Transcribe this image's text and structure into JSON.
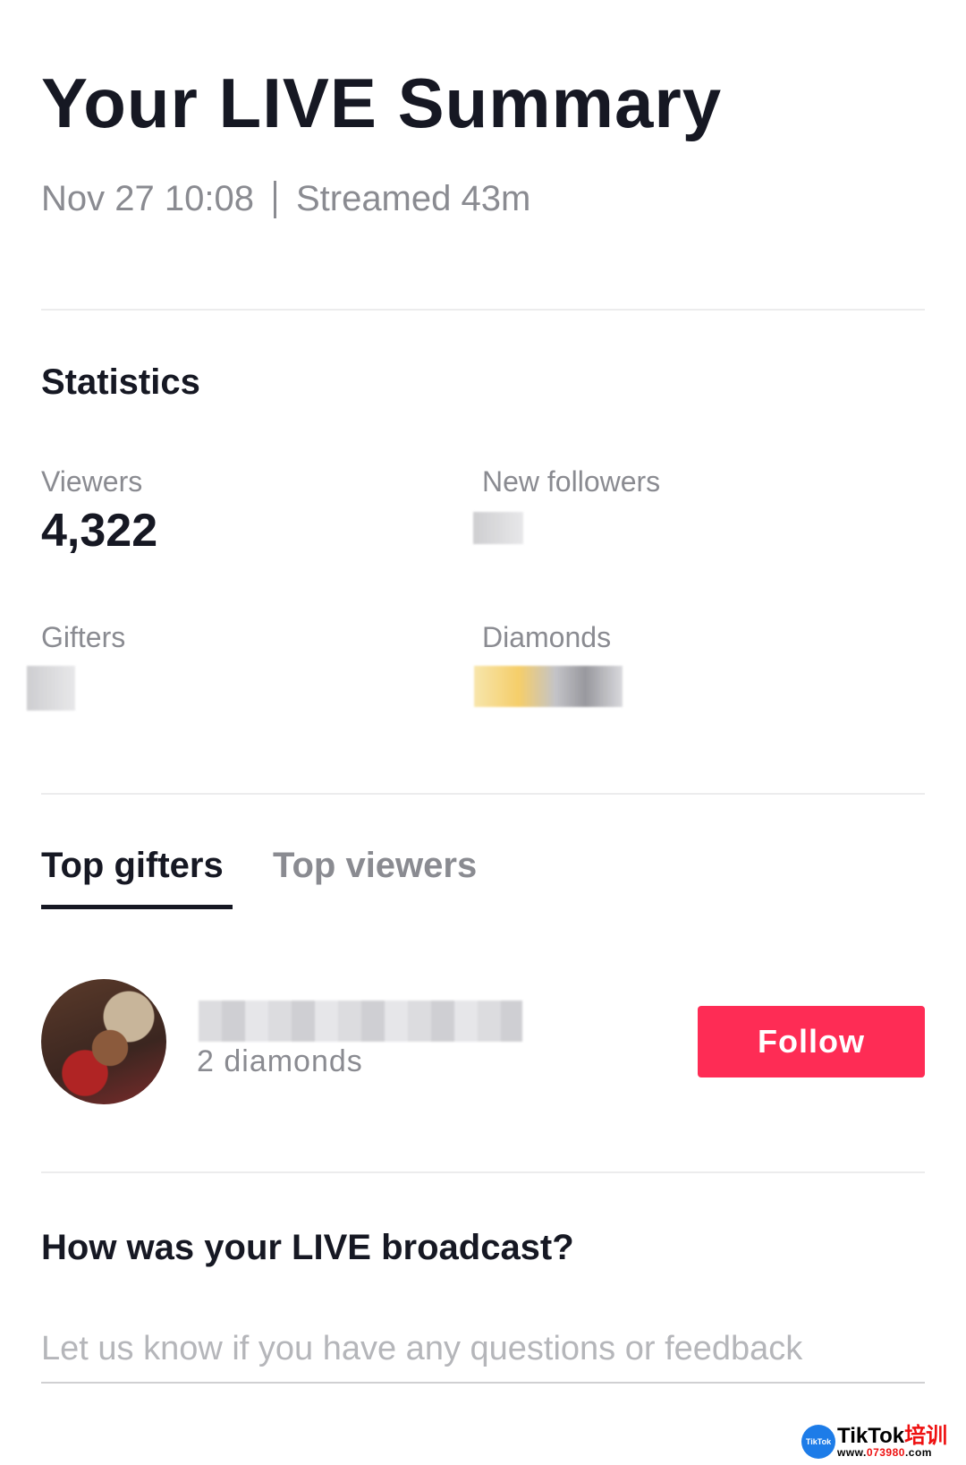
{
  "header": {
    "title": "Your LIVE Summary",
    "date": "Nov 27 10:08",
    "duration": "Streamed 43m"
  },
  "statistics": {
    "heading": "Statistics",
    "viewers_label": "Viewers",
    "viewers_value": "4,322",
    "new_followers_label": "New followers",
    "gifters_label": "Gifters",
    "diamonds_label": "Diamonds"
  },
  "tabs": [
    {
      "label": "Top gifters",
      "active": true
    },
    {
      "label": "Top viewers",
      "active": false
    }
  ],
  "top_gifters": [
    {
      "gift_text": "2 diamonds",
      "follow_label": "Follow"
    }
  ],
  "feedback": {
    "question": "How was your LIVE broadcast?",
    "placeholder": "Let us know if you have any questions or feedback"
  },
  "watermark": {
    "badge": "TikTok",
    "brand": "TikTok",
    "brand_cn": "培训",
    "url_prefix": "www.",
    "url_number": "073980",
    "url_suffix": ".com"
  },
  "colors": {
    "accent": "#fe2c55",
    "text_primary": "#161823",
    "text_secondary": "#8a8b91"
  }
}
